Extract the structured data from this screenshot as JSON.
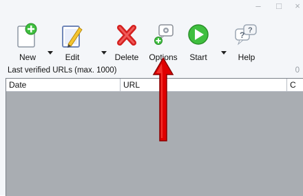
{
  "toolbar": {
    "new_label": "New",
    "edit_label": "Edit",
    "delete_label": "Delete",
    "options_label": "Options",
    "start_label": "Start",
    "help_label": "Help"
  },
  "status": {
    "caption": "Last verified URLs (max. 1000)",
    "count": "0"
  },
  "table": {
    "columns": [
      "Date",
      "URL",
      "C"
    ]
  },
  "window": {
    "minimize_glyph": "–",
    "maximize_glyph": "□",
    "close_glyph": "×"
  },
  "colors": {
    "accent_green": "#3fbf3f",
    "delete_red": "#d4201f",
    "arrow_red": "#e00000",
    "grid_empty_bg": "#a9adb2"
  }
}
